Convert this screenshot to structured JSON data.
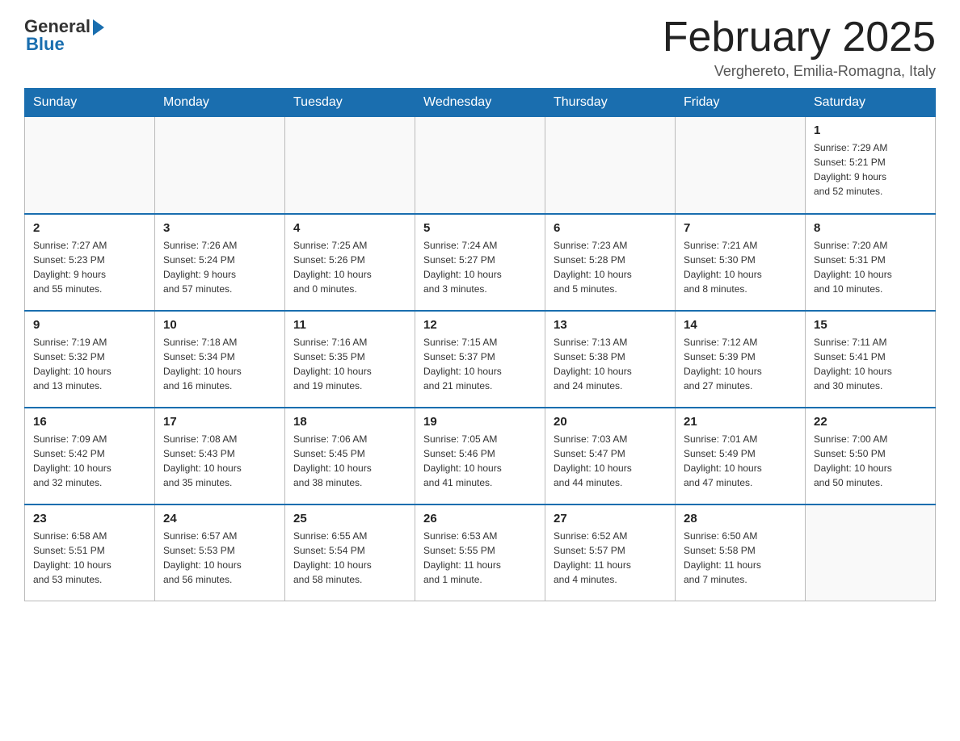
{
  "logo": {
    "general": "General",
    "blue": "Blue"
  },
  "title": {
    "month": "February 2025",
    "location": "Verghereto, Emilia-Romagna, Italy"
  },
  "days_of_week": [
    "Sunday",
    "Monday",
    "Tuesday",
    "Wednesday",
    "Thursday",
    "Friday",
    "Saturday"
  ],
  "weeks": [
    [
      {
        "day": "",
        "info": ""
      },
      {
        "day": "",
        "info": ""
      },
      {
        "day": "",
        "info": ""
      },
      {
        "day": "",
        "info": ""
      },
      {
        "day": "",
        "info": ""
      },
      {
        "day": "",
        "info": ""
      },
      {
        "day": "1",
        "info": "Sunrise: 7:29 AM\nSunset: 5:21 PM\nDaylight: 9 hours\nand 52 minutes."
      }
    ],
    [
      {
        "day": "2",
        "info": "Sunrise: 7:27 AM\nSunset: 5:23 PM\nDaylight: 9 hours\nand 55 minutes."
      },
      {
        "day": "3",
        "info": "Sunrise: 7:26 AM\nSunset: 5:24 PM\nDaylight: 9 hours\nand 57 minutes."
      },
      {
        "day": "4",
        "info": "Sunrise: 7:25 AM\nSunset: 5:26 PM\nDaylight: 10 hours\nand 0 minutes."
      },
      {
        "day": "5",
        "info": "Sunrise: 7:24 AM\nSunset: 5:27 PM\nDaylight: 10 hours\nand 3 minutes."
      },
      {
        "day": "6",
        "info": "Sunrise: 7:23 AM\nSunset: 5:28 PM\nDaylight: 10 hours\nand 5 minutes."
      },
      {
        "day": "7",
        "info": "Sunrise: 7:21 AM\nSunset: 5:30 PM\nDaylight: 10 hours\nand 8 minutes."
      },
      {
        "day": "8",
        "info": "Sunrise: 7:20 AM\nSunset: 5:31 PM\nDaylight: 10 hours\nand 10 minutes."
      }
    ],
    [
      {
        "day": "9",
        "info": "Sunrise: 7:19 AM\nSunset: 5:32 PM\nDaylight: 10 hours\nand 13 minutes."
      },
      {
        "day": "10",
        "info": "Sunrise: 7:18 AM\nSunset: 5:34 PM\nDaylight: 10 hours\nand 16 minutes."
      },
      {
        "day": "11",
        "info": "Sunrise: 7:16 AM\nSunset: 5:35 PM\nDaylight: 10 hours\nand 19 minutes."
      },
      {
        "day": "12",
        "info": "Sunrise: 7:15 AM\nSunset: 5:37 PM\nDaylight: 10 hours\nand 21 minutes."
      },
      {
        "day": "13",
        "info": "Sunrise: 7:13 AM\nSunset: 5:38 PM\nDaylight: 10 hours\nand 24 minutes."
      },
      {
        "day": "14",
        "info": "Sunrise: 7:12 AM\nSunset: 5:39 PM\nDaylight: 10 hours\nand 27 minutes."
      },
      {
        "day": "15",
        "info": "Sunrise: 7:11 AM\nSunset: 5:41 PM\nDaylight: 10 hours\nand 30 minutes."
      }
    ],
    [
      {
        "day": "16",
        "info": "Sunrise: 7:09 AM\nSunset: 5:42 PM\nDaylight: 10 hours\nand 32 minutes."
      },
      {
        "day": "17",
        "info": "Sunrise: 7:08 AM\nSunset: 5:43 PM\nDaylight: 10 hours\nand 35 minutes."
      },
      {
        "day": "18",
        "info": "Sunrise: 7:06 AM\nSunset: 5:45 PM\nDaylight: 10 hours\nand 38 minutes."
      },
      {
        "day": "19",
        "info": "Sunrise: 7:05 AM\nSunset: 5:46 PM\nDaylight: 10 hours\nand 41 minutes."
      },
      {
        "day": "20",
        "info": "Sunrise: 7:03 AM\nSunset: 5:47 PM\nDaylight: 10 hours\nand 44 minutes."
      },
      {
        "day": "21",
        "info": "Sunrise: 7:01 AM\nSunset: 5:49 PM\nDaylight: 10 hours\nand 47 minutes."
      },
      {
        "day": "22",
        "info": "Sunrise: 7:00 AM\nSunset: 5:50 PM\nDaylight: 10 hours\nand 50 minutes."
      }
    ],
    [
      {
        "day": "23",
        "info": "Sunrise: 6:58 AM\nSunset: 5:51 PM\nDaylight: 10 hours\nand 53 minutes."
      },
      {
        "day": "24",
        "info": "Sunrise: 6:57 AM\nSunset: 5:53 PM\nDaylight: 10 hours\nand 56 minutes."
      },
      {
        "day": "25",
        "info": "Sunrise: 6:55 AM\nSunset: 5:54 PM\nDaylight: 10 hours\nand 58 minutes."
      },
      {
        "day": "26",
        "info": "Sunrise: 6:53 AM\nSunset: 5:55 PM\nDaylight: 11 hours\nand 1 minute."
      },
      {
        "day": "27",
        "info": "Sunrise: 6:52 AM\nSunset: 5:57 PM\nDaylight: 11 hours\nand 4 minutes."
      },
      {
        "day": "28",
        "info": "Sunrise: 6:50 AM\nSunset: 5:58 PM\nDaylight: 11 hours\nand 7 minutes."
      },
      {
        "day": "",
        "info": ""
      }
    ]
  ]
}
